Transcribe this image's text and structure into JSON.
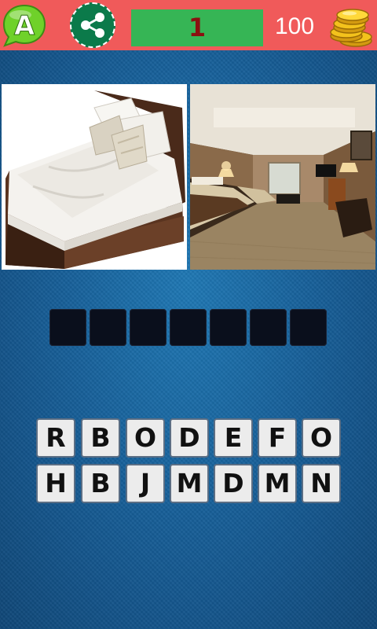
{
  "header": {
    "hint_letter": "A",
    "level": "1",
    "coins": "100"
  },
  "icons": {
    "hint": "hint-letter-icon",
    "share": "share-icon",
    "coins": "gold-coins-icon"
  },
  "colors": {
    "topbar": "#f05a5a",
    "level_box": "#36b555",
    "level_text": "#8b1010",
    "background": "#17609a",
    "slot": "#0a0f1c",
    "tile": "#ececec"
  },
  "pictures": [
    {
      "name": "picture-bed"
    },
    {
      "name": "picture-hotel-room"
    }
  ],
  "answer": {
    "length": 7,
    "letters": [
      "",
      "",
      "",
      "",
      "",
      "",
      ""
    ]
  },
  "letters_row1": [
    "R",
    "B",
    "O",
    "D",
    "E",
    "F",
    "O"
  ],
  "letters_row2": [
    "H",
    "B",
    "J",
    "M",
    "D",
    "M",
    "N"
  ]
}
